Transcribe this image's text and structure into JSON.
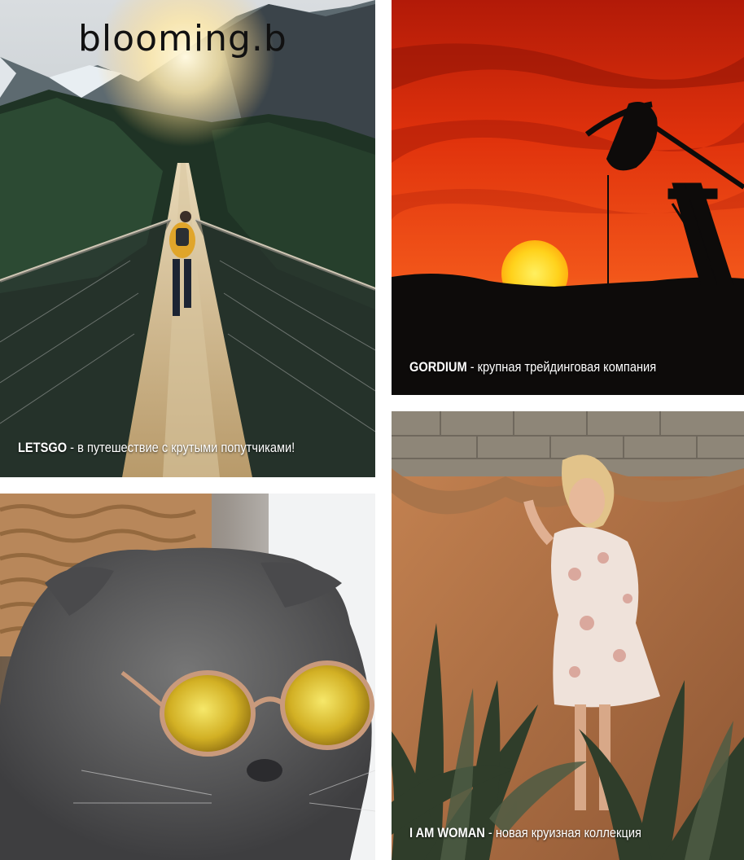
{
  "logo": {
    "text": "blooming.b"
  },
  "tiles": [
    {
      "brand": "LETSGO",
      "text": " - в путешествие с крутыми попутчиками!"
    },
    {
      "brand": "GORDIUM",
      "text": " - крупная трейдинговая компания"
    },
    {
      "brand": "I AM WOMAN",
      "text": " - новая круизная коллекция"
    }
  ],
  "colors": {
    "background": "#ffffff",
    "caption": "#ffffff"
  }
}
